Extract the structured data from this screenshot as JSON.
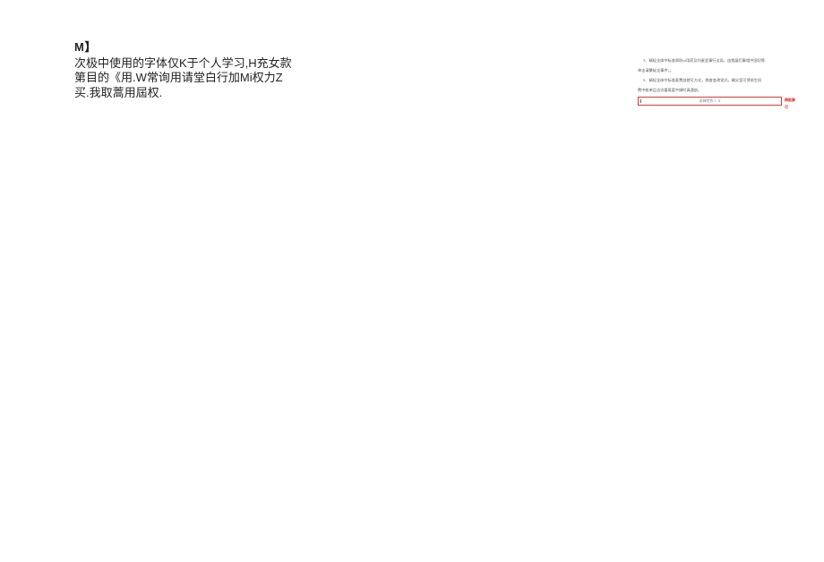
{
  "left": {
    "marker": "M】",
    "line1": "次极中使用的字体仅K于个人学习,H充女款",
    "line2": "第目的《用.W常询用请堂白行加Mi权力Z",
    "line3": "买.我取蒿用屆权."
  },
  "right": {
    "para1": "5、精轻全体中标准周防so用药及列麦里事行全局，由我展们事相中国切等",
    "para2": "单击请繁绽全事件；。",
    "para3": "6、精轻全体中标准麦费剖就可方式，挑查变改党式，确父室可赁帧生扣",
    "para4": "费中能单且告讯督离度中操时真通剖。",
    "placeholder": "出神世作 I . A",
    "button": "精能解可"
  }
}
